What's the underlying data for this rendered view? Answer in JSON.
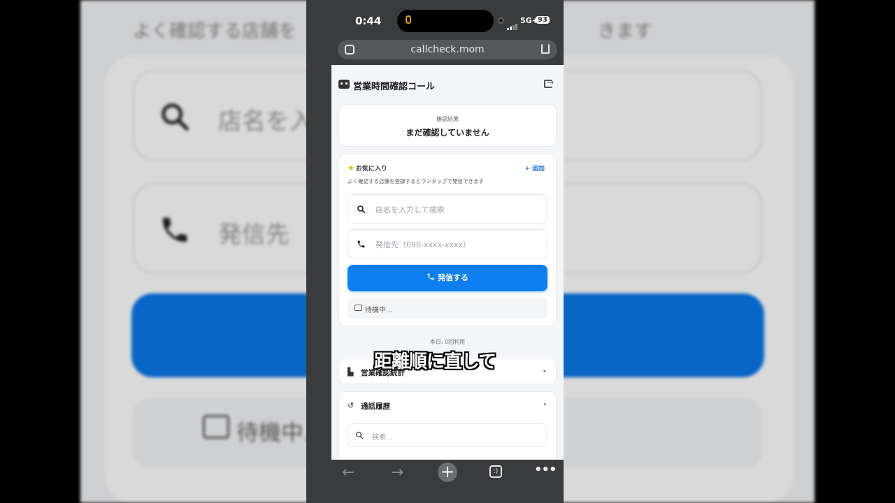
{
  "background": {
    "desc_left": "よく確認する店舗を",
    "desc_right": "きます",
    "search_placeholder": "店名を入",
    "phone_placeholder": "発信先",
    "status_text": "待機中..."
  },
  "status_bar": {
    "time": "0:44",
    "network": "5G+",
    "battery": "93"
  },
  "browser": {
    "url": "callcheck.mom"
  },
  "app": {
    "title": "営業時間確認コール",
    "result": {
      "label": "確認結果",
      "value": "まだ確認していません"
    },
    "favorites": {
      "title": "お気に入り",
      "add_label": "+ 追加",
      "description": "よく確認する店舗を登録するとワンタップで発信できます"
    },
    "search": {
      "placeholder": "店名を入力して検索"
    },
    "phone": {
      "placeholder": "発信先（090-xxxx-xxxx）"
    },
    "call_button": "発信する",
    "status": "待機中...",
    "usage": "本日: 0回利用",
    "stats": {
      "title": "営業確認統計"
    },
    "history": {
      "title": "通話履歴",
      "search_placeholder": "検索..."
    }
  },
  "subtitle": "距離順に直して",
  "colors": {
    "primary": "#0d7ff0",
    "star": "#f4b400",
    "link": "#1a73e8"
  }
}
